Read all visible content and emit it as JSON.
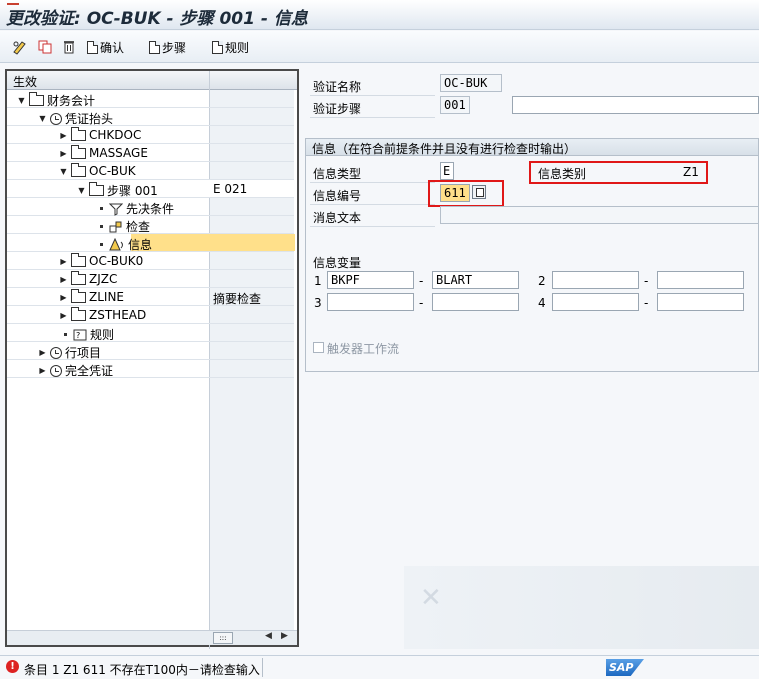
{
  "window": {
    "title": "更改验证: OC-BUK - 步骤 001 - 信息"
  },
  "toolbar": {
    "confirm_label": "确认",
    "step_label": "步骤",
    "rule_label": "规则"
  },
  "tree": {
    "column_header": "生效",
    "nodes": [
      {
        "label": "财务会计",
        "col2": ""
      },
      {
        "label": "凭证抬头",
        "col2": ""
      },
      {
        "label": "CHKDOC",
        "col2": ""
      },
      {
        "label": "MASSAGE",
        "col2": ""
      },
      {
        "label": "OC-BUK",
        "col2": ""
      },
      {
        "label": "步骤 001",
        "col2": "E 021"
      },
      {
        "label": "先决条件",
        "col2": ""
      },
      {
        "label": "检查",
        "col2": ""
      },
      {
        "label": "信息",
        "col2": ""
      },
      {
        "label": "OC-BUK0",
        "col2": ""
      },
      {
        "label": "ZJZC",
        "col2": ""
      },
      {
        "label": "ZLINE",
        "col2": "摘要检查"
      },
      {
        "label": "ZSTHEAD",
        "col2": ""
      },
      {
        "label": "规则",
        "col2": ""
      },
      {
        "label": "行项目",
        "col2": ""
      },
      {
        "label": "完全凭证",
        "col2": ""
      }
    ]
  },
  "form": {
    "validation_name_label": "验证名称",
    "validation_name_value": "OC-BUK",
    "validation_step_label": "验证步骤",
    "validation_step_value": "001",
    "validation_step_desc": ""
  },
  "message_group": {
    "title": "信息（在符合前提条件并且没有进行检查时输出）",
    "type_label": "信息类型",
    "type_value": "E",
    "class_label": "信息类别",
    "class_value": "Z1",
    "number_label": "信息编号",
    "number_value": "611",
    "text_label": "消息文本",
    "text_value": "",
    "vars_label": "信息变量",
    "vars": [
      {
        "index": "1",
        "table": "BKPF",
        "field": "BLART"
      },
      {
        "index": "2",
        "table": "",
        "field": ""
      },
      {
        "index": "3",
        "table": "",
        "field": ""
      },
      {
        "index": "4",
        "table": "",
        "field": ""
      }
    ],
    "dash": "-",
    "workflow_label": "触发器工作流"
  },
  "status": {
    "message": "条目 1 Z1 611 不存在T100内－请检查输入",
    "logo": "SAP"
  },
  "colors": {
    "highlight": "#ffe08a",
    "error_box": "#e01818"
  }
}
